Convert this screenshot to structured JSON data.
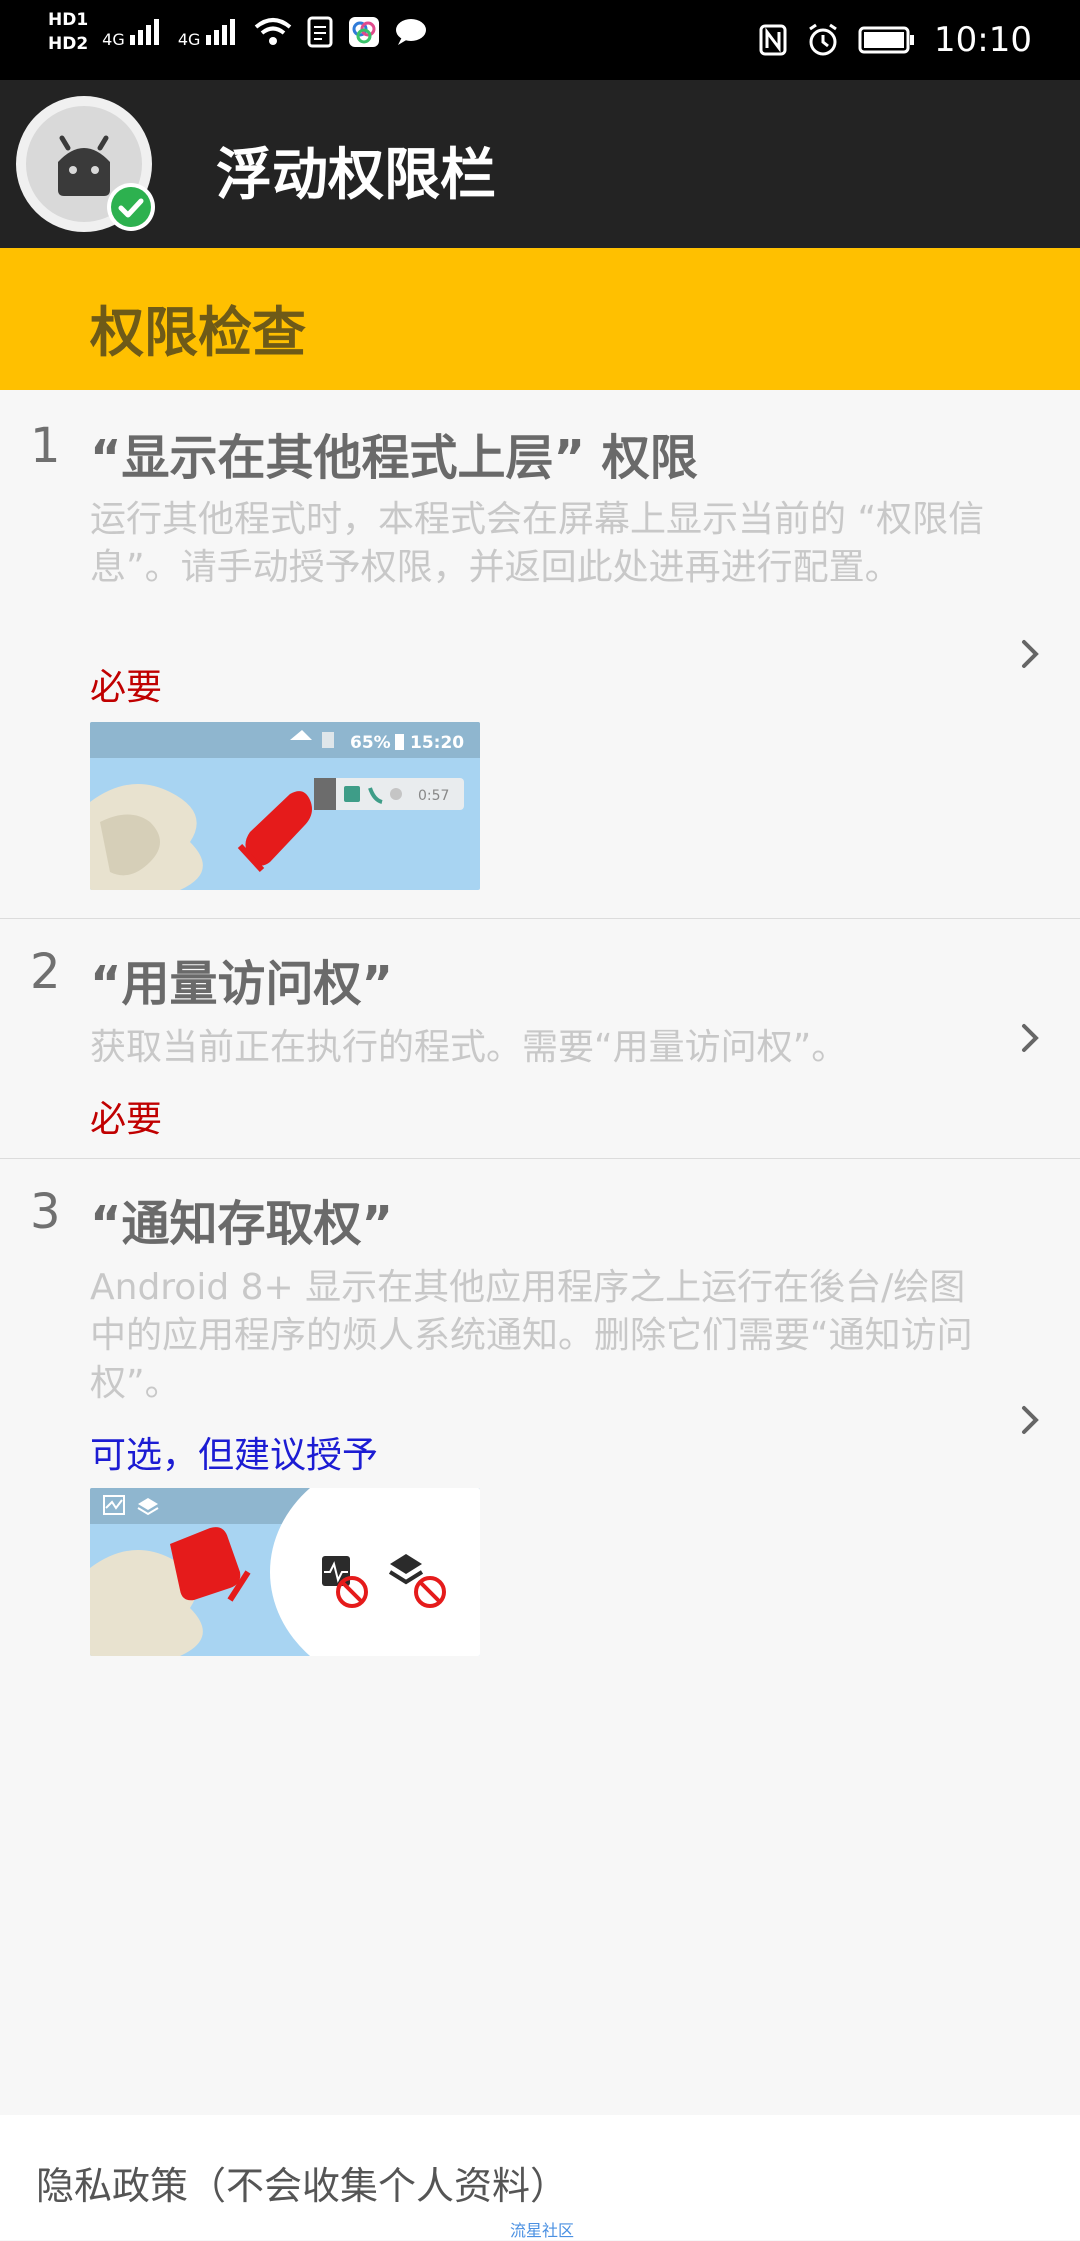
{
  "status_bar": {
    "hd1": "HD1",
    "hd2": "HD2",
    "sig1": "4G",
    "sig2": "4G",
    "time": "10:10",
    "icons": [
      "wifi-icon",
      "sim-icon",
      "app-icon",
      "chat-icon",
      "nfc-icon",
      "alarm-icon",
      "battery-icon"
    ]
  },
  "app": {
    "title": "浮动权限栏"
  },
  "section": {
    "title": "权限检查"
  },
  "items": [
    {
      "number": "1",
      "title": "“显示在其他程式上层” 权限",
      "description": "运行其他程式时，本程式会在屏幕上显示当前的 “权限信息”。请手动授予权限，并返回此处进再进行配置。",
      "badge": "必要",
      "preview": {
        "status_text": "65%",
        "time_text": "15:20",
        "timer_text": "0:57"
      }
    },
    {
      "number": "2",
      "title": "“用量访问权”",
      "description": "获取当前正在执行的程式。需要“用量访问权”。",
      "badge": "必要"
    },
    {
      "number": "3",
      "title": "“通知存取权”",
      "description": "Android 8+ 显示在其他应用程序之上运行在後台/绘图中的应用程序的烦人系统通知。删除它们需要“通知访问权”。",
      "badge": "可选，但建议授予"
    }
  ],
  "footer": {
    "policy": "隐私政策（不会收集个人资料）",
    "mark": "流星社区"
  },
  "colors": {
    "accent": "#FFC000",
    "required": "#C00000",
    "optional": "#1C1CD3",
    "appbar": "#232323"
  }
}
